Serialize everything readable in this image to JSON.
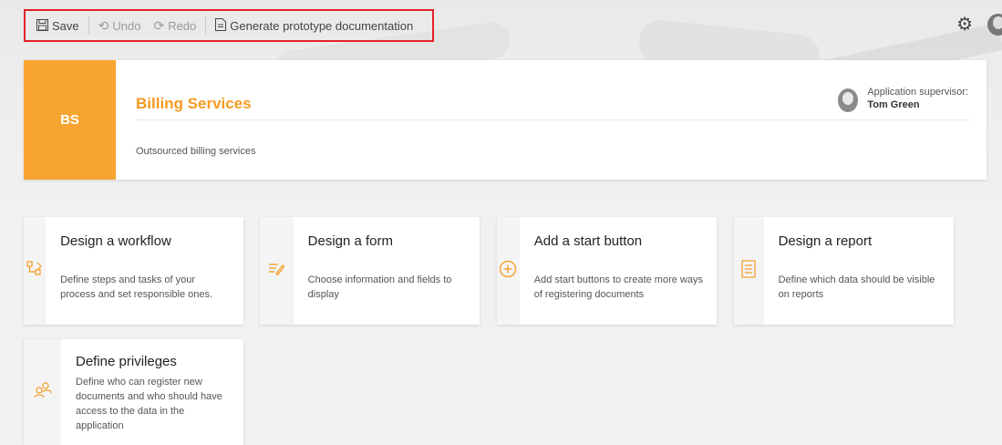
{
  "toolbar": {
    "save_label": "Save",
    "undo_label": "Undo",
    "redo_label": "Redo",
    "generate_label": "Generate prototype documentation"
  },
  "app": {
    "badge": "BS",
    "title": "Billing Services",
    "description": "Outsourced billing services",
    "supervisor_label": "Application supervisor:",
    "supervisor_name": "Tom Green"
  },
  "tiles": [
    {
      "title": "Design a workflow",
      "desc": "Define steps and tasks of your process and set responsible ones.",
      "icon": "workflow-icon"
    },
    {
      "title": "Design a form",
      "desc": "Choose information and fields to display",
      "icon": "form-edit-icon"
    },
    {
      "title": "Add a start button",
      "desc": "Add start buttons to create more ways of registering documents",
      "icon": "plus-circle-icon"
    },
    {
      "title": "Design a report",
      "desc": "Define which data should be visible on reports",
      "icon": "report-icon"
    },
    {
      "title": "Define privileges",
      "desc": "Define who can register new documents and who should have access to the data in the application",
      "icon": "users-icon"
    }
  ],
  "colors": {
    "accent": "#f7a530",
    "highlight_border": "#e1232b"
  }
}
